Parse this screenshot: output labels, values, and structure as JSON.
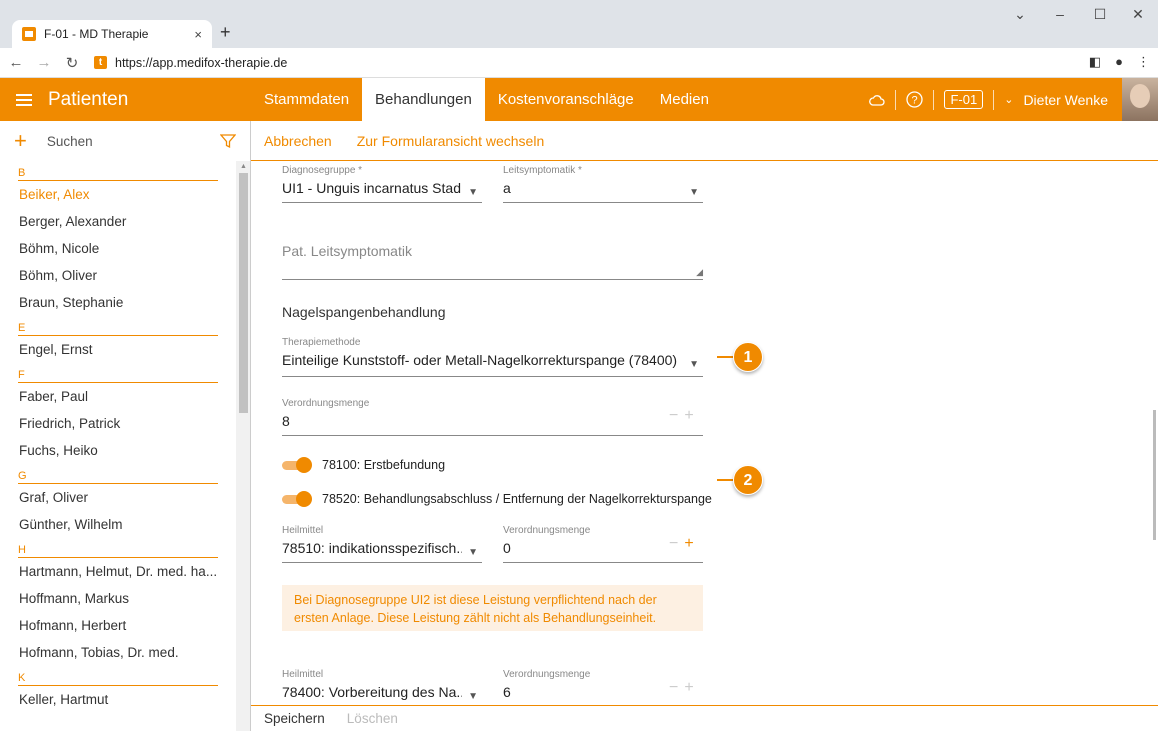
{
  "browser": {
    "tab_title": "F-01 - MD Therapie",
    "tab_close": "×",
    "new_tab": "+",
    "url": "https://app.medifox-therapie.de",
    "win_controls": [
      "⌄",
      "–",
      "☐",
      "✕"
    ]
  },
  "left_header": {
    "title": "Patienten"
  },
  "search": {
    "label": "Suchen"
  },
  "patients": [
    {
      "letter": "B",
      "names": [
        "Beiker, Alex",
        "Berger, Alexander",
        "Böhm, Nicole",
        "Böhm, Oliver",
        "Braun, Stephanie"
      ]
    },
    {
      "letter": "E",
      "names": [
        "Engel, Ernst"
      ]
    },
    {
      "letter": "F",
      "names": [
        "Faber, Paul",
        "Friedrich, Patrick",
        "Fuchs, Heiko"
      ]
    },
    {
      "letter": "G",
      "names": [
        "Graf, Oliver",
        "Günther, Wilhelm"
      ]
    },
    {
      "letter": "H",
      "names": [
        "Hartmann, Helmut, Dr. med. ha...",
        "Hoffmann, Markus",
        "Hofmann, Herbert",
        "Hofmann, Tobias, Dr. med."
      ]
    },
    {
      "letter": "K",
      "names": [
        "Keller, Hartmut"
      ]
    }
  ],
  "selected_patient": "Beiker, Alex",
  "nav": {
    "tabs": [
      "Stammdaten",
      "Behandlungen",
      "Kostenvoranschläge",
      "Medien"
    ],
    "active_tab": "Behandlungen",
    "badge": "F-01",
    "user": "Dieter Wenke"
  },
  "actions": {
    "cancel": "Abbrechen",
    "switch_view": "Zur Formularansicht wechseln"
  },
  "form": {
    "diagnosegruppe_label": "Diagnosegruppe *",
    "diagnosegruppe_value": "UI1 - Unguis incarnatus Stad...",
    "leitsymptomatik_label": "Leitsymptomatik *",
    "leitsymptomatik_value": "a",
    "pat_leitsymptomatik_placeholder": "Pat. Leitsymptomatik",
    "section_title": "Nagelspangenbehandlung",
    "therapiemethode_label": "Therapiemethode",
    "therapiemethode_value": "Einteilige Kunststoff- oder Metall-Nagelkorrekturspange (78400)",
    "verordnungsmenge_label": "Verordnungsmenge",
    "verordnungsmenge_value": "8",
    "toggle1_label": "78100: Erstbefundung",
    "toggle2_label": "78520: Behandlungsabschluss / Entfernung der Nagelkorrekturspange",
    "heilmittel1_label": "Heilmittel",
    "heilmittel1_value": "78510: indikationsspezifisch...",
    "menge1_label": "Verordnungsmenge",
    "menge1_value": "0",
    "info_text": "Bei Diagnosegruppe UI2 ist diese Leistung verpflichtend nach der ersten Anlage. Diese Leistung zählt nicht als Behandlungseinheit.",
    "heilmittel2_label": "Heilmittel",
    "heilmittel2_value": "78400: Vorbereitung des Na...",
    "menge2_label": "Verordnungsmenge",
    "menge2_value": "6"
  },
  "callouts": [
    "1",
    "2"
  ],
  "bottom": {
    "save": "Speichern",
    "delete": "Löschen"
  },
  "colors": {
    "accent": "#f08a00",
    "info_bg": "#fdf0e2"
  }
}
